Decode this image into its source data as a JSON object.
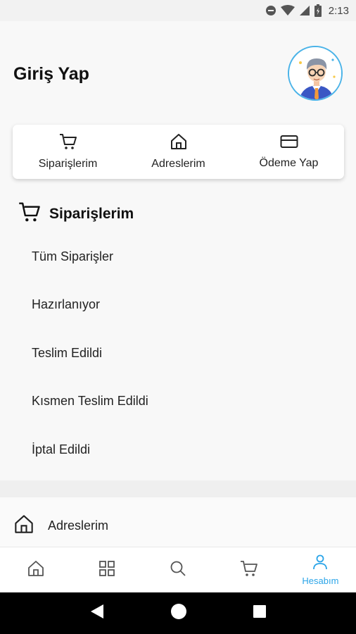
{
  "status_bar": {
    "time": "2:13"
  },
  "header": {
    "title": "Giriş Yap"
  },
  "quick_actions": [
    {
      "label": "Siparişlerim",
      "icon": "cart-icon"
    },
    {
      "label": "Adreslerim",
      "icon": "home-icon"
    },
    {
      "label": "Ödeme Yap",
      "icon": "credit-card-icon"
    }
  ],
  "orders_section": {
    "title": "Siparişlerim",
    "items": [
      "Tüm Siparişler",
      "Hazırlanıyor",
      "Teslim Edildi",
      "Kısmen Teslim Edildi",
      "İptal Edildi"
    ]
  },
  "address_row": {
    "label": "Adreslerim"
  },
  "bottom_nav": {
    "items": [
      "home-icon",
      "categories-icon",
      "search-icon",
      "cart-icon",
      "account-icon"
    ],
    "active_label": "Hesabım"
  },
  "colors": {
    "accent": "#2aa4e8",
    "background": "#f8f8f8"
  }
}
